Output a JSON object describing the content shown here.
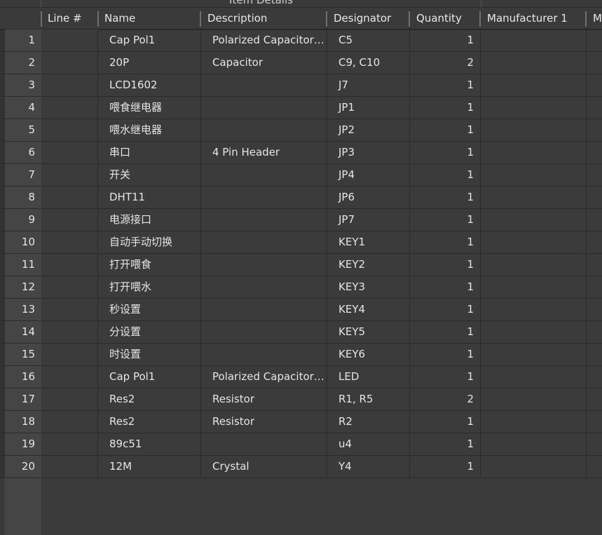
{
  "grid": {
    "group_title": "Item Details",
    "columns": [
      "",
      "Line #",
      "Name",
      "Description",
      "Designator",
      "Quantity",
      "Manufacturer 1",
      "M"
    ],
    "rows": [
      {
        "idx": "1",
        "line": "",
        "name": "Cap Pol1",
        "desc": "Polarized Capacitor (Radial)",
        "designator": "C5",
        "qty": "1"
      },
      {
        "idx": "2",
        "line": "",
        "name": "20P",
        "desc": "Capacitor",
        "designator": "C9, C10",
        "qty": "2"
      },
      {
        "idx": "3",
        "line": "",
        "name": "LCD1602",
        "desc": "",
        "designator": "J7",
        "qty": "1"
      },
      {
        "idx": "4",
        "line": "",
        "name": "喂食继电器",
        "desc": "",
        "designator": "JP1",
        "qty": "1"
      },
      {
        "idx": "5",
        "line": "",
        "name": "喂水继电器",
        "desc": "",
        "designator": "JP2",
        "qty": "1"
      },
      {
        "idx": "6",
        "line": "",
        "name": "串口",
        "desc": "4 Pin Header",
        "designator": "JP3",
        "qty": "1"
      },
      {
        "idx": "7",
        "line": "",
        "name": "开关",
        "desc": "",
        "designator": "JP4",
        "qty": "1"
      },
      {
        "idx": "8",
        "line": "",
        "name": "DHT11",
        "desc": "",
        "designator": "JP6",
        "qty": "1"
      },
      {
        "idx": "9",
        "line": "",
        "name": "电源接口",
        "desc": "",
        "designator": "JP7",
        "qty": "1"
      },
      {
        "idx": "10",
        "line": "",
        "name": "自动手动切换",
        "desc": "",
        "designator": "KEY1",
        "qty": "1"
      },
      {
        "idx": "11",
        "line": "",
        "name": "打开喂食",
        "desc": "",
        "designator": "KEY2",
        "qty": "1"
      },
      {
        "idx": "12",
        "line": "",
        "name": "打开喂水",
        "desc": "",
        "designator": "KEY3",
        "qty": "1"
      },
      {
        "idx": "13",
        "line": "",
        "name": "秒设置",
        "desc": "",
        "designator": "KEY4",
        "qty": "1"
      },
      {
        "idx": "14",
        "line": "",
        "name": "分设置",
        "desc": "",
        "designator": "KEY5",
        "qty": "1"
      },
      {
        "idx": "15",
        "line": "",
        "name": "时设置",
        "desc": "",
        "designator": "KEY6",
        "qty": "1"
      },
      {
        "idx": "16",
        "line": "",
        "name": "Cap Pol1",
        "desc": "Polarized Capacitor (Radial)",
        "designator": "LED",
        "qty": "1"
      },
      {
        "idx": "17",
        "line": "",
        "name": "Res2",
        "desc": "Resistor",
        "designator": "R1, R5",
        "qty": "2"
      },
      {
        "idx": "18",
        "line": "",
        "name": "Res2",
        "desc": "Resistor",
        "designator": "R2",
        "qty": "1"
      },
      {
        "idx": "19",
        "line": "",
        "name": "89c51",
        "desc": "",
        "designator": "u4",
        "qty": "1"
      },
      {
        "idx": "20",
        "line": "",
        "name": "12M",
        "desc": "Crystal",
        "designator": "Y4",
        "qty": "1"
      }
    ]
  }
}
